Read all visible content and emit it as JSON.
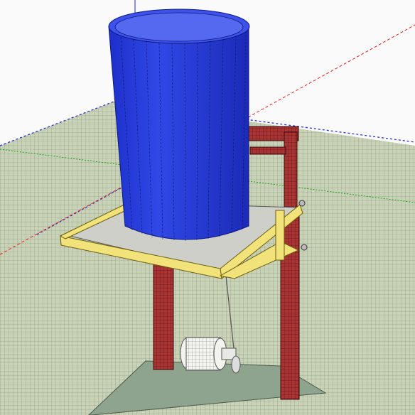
{
  "scene": {
    "kind": "3d-model-viewport",
    "objects": [
      {
        "name": "water-tank",
        "color": "#2a3fd8"
      },
      {
        "name": "tilting-platform",
        "color": "#f2e27a"
      },
      {
        "name": "support-frame",
        "color": "#b81d1d"
      },
      {
        "name": "cable-drum",
        "color": "#f0f0ec"
      },
      {
        "name": "base-slab",
        "color": "#8fa48e"
      },
      {
        "name": "ground-grid",
        "color": "#c7d0b4"
      }
    ],
    "axes": {
      "red": "#e02020",
      "green": "#18a418",
      "blue": "#2020e0"
    }
  }
}
